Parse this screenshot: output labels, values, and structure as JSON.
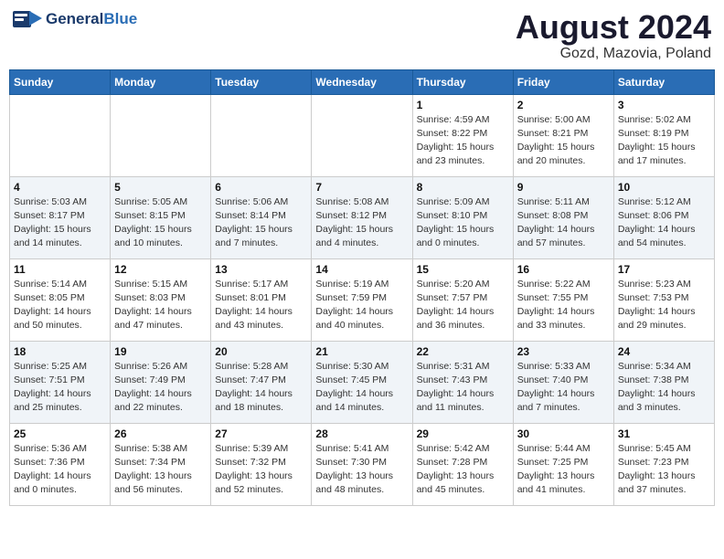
{
  "header": {
    "logo_general": "General",
    "logo_blue": "Blue",
    "title": "August 2024",
    "subtitle": "Gozd, Mazovia, Poland"
  },
  "weekdays": [
    "Sunday",
    "Monday",
    "Tuesday",
    "Wednesday",
    "Thursday",
    "Friday",
    "Saturday"
  ],
  "weeks": [
    [
      {
        "day": "",
        "info": ""
      },
      {
        "day": "",
        "info": ""
      },
      {
        "day": "",
        "info": ""
      },
      {
        "day": "",
        "info": ""
      },
      {
        "day": "1",
        "info": "Sunrise: 4:59 AM\nSunset: 8:22 PM\nDaylight: 15 hours\nand 23 minutes."
      },
      {
        "day": "2",
        "info": "Sunrise: 5:00 AM\nSunset: 8:21 PM\nDaylight: 15 hours\nand 20 minutes."
      },
      {
        "day": "3",
        "info": "Sunrise: 5:02 AM\nSunset: 8:19 PM\nDaylight: 15 hours\nand 17 minutes."
      }
    ],
    [
      {
        "day": "4",
        "info": "Sunrise: 5:03 AM\nSunset: 8:17 PM\nDaylight: 15 hours\nand 14 minutes."
      },
      {
        "day": "5",
        "info": "Sunrise: 5:05 AM\nSunset: 8:15 PM\nDaylight: 15 hours\nand 10 minutes."
      },
      {
        "day": "6",
        "info": "Sunrise: 5:06 AM\nSunset: 8:14 PM\nDaylight: 15 hours\nand 7 minutes."
      },
      {
        "day": "7",
        "info": "Sunrise: 5:08 AM\nSunset: 8:12 PM\nDaylight: 15 hours\nand 4 minutes."
      },
      {
        "day": "8",
        "info": "Sunrise: 5:09 AM\nSunset: 8:10 PM\nDaylight: 15 hours\nand 0 minutes."
      },
      {
        "day": "9",
        "info": "Sunrise: 5:11 AM\nSunset: 8:08 PM\nDaylight: 14 hours\nand 57 minutes."
      },
      {
        "day": "10",
        "info": "Sunrise: 5:12 AM\nSunset: 8:06 PM\nDaylight: 14 hours\nand 54 minutes."
      }
    ],
    [
      {
        "day": "11",
        "info": "Sunrise: 5:14 AM\nSunset: 8:05 PM\nDaylight: 14 hours\nand 50 minutes."
      },
      {
        "day": "12",
        "info": "Sunrise: 5:15 AM\nSunset: 8:03 PM\nDaylight: 14 hours\nand 47 minutes."
      },
      {
        "day": "13",
        "info": "Sunrise: 5:17 AM\nSunset: 8:01 PM\nDaylight: 14 hours\nand 43 minutes."
      },
      {
        "day": "14",
        "info": "Sunrise: 5:19 AM\nSunset: 7:59 PM\nDaylight: 14 hours\nand 40 minutes."
      },
      {
        "day": "15",
        "info": "Sunrise: 5:20 AM\nSunset: 7:57 PM\nDaylight: 14 hours\nand 36 minutes."
      },
      {
        "day": "16",
        "info": "Sunrise: 5:22 AM\nSunset: 7:55 PM\nDaylight: 14 hours\nand 33 minutes."
      },
      {
        "day": "17",
        "info": "Sunrise: 5:23 AM\nSunset: 7:53 PM\nDaylight: 14 hours\nand 29 minutes."
      }
    ],
    [
      {
        "day": "18",
        "info": "Sunrise: 5:25 AM\nSunset: 7:51 PM\nDaylight: 14 hours\nand 25 minutes."
      },
      {
        "day": "19",
        "info": "Sunrise: 5:26 AM\nSunset: 7:49 PM\nDaylight: 14 hours\nand 22 minutes."
      },
      {
        "day": "20",
        "info": "Sunrise: 5:28 AM\nSunset: 7:47 PM\nDaylight: 14 hours\nand 18 minutes."
      },
      {
        "day": "21",
        "info": "Sunrise: 5:30 AM\nSunset: 7:45 PM\nDaylight: 14 hours\nand 14 minutes."
      },
      {
        "day": "22",
        "info": "Sunrise: 5:31 AM\nSunset: 7:43 PM\nDaylight: 14 hours\nand 11 minutes."
      },
      {
        "day": "23",
        "info": "Sunrise: 5:33 AM\nSunset: 7:40 PM\nDaylight: 14 hours\nand 7 minutes."
      },
      {
        "day": "24",
        "info": "Sunrise: 5:34 AM\nSunset: 7:38 PM\nDaylight: 14 hours\nand 3 minutes."
      }
    ],
    [
      {
        "day": "25",
        "info": "Sunrise: 5:36 AM\nSunset: 7:36 PM\nDaylight: 14 hours\nand 0 minutes."
      },
      {
        "day": "26",
        "info": "Sunrise: 5:38 AM\nSunset: 7:34 PM\nDaylight: 13 hours\nand 56 minutes."
      },
      {
        "day": "27",
        "info": "Sunrise: 5:39 AM\nSunset: 7:32 PM\nDaylight: 13 hours\nand 52 minutes."
      },
      {
        "day": "28",
        "info": "Sunrise: 5:41 AM\nSunset: 7:30 PM\nDaylight: 13 hours\nand 48 minutes."
      },
      {
        "day": "29",
        "info": "Sunrise: 5:42 AM\nSunset: 7:28 PM\nDaylight: 13 hours\nand 45 minutes."
      },
      {
        "day": "30",
        "info": "Sunrise: 5:44 AM\nSunset: 7:25 PM\nDaylight: 13 hours\nand 41 minutes."
      },
      {
        "day": "31",
        "info": "Sunrise: 5:45 AM\nSunset: 7:23 PM\nDaylight: 13 hours\nand 37 minutes."
      }
    ]
  ]
}
